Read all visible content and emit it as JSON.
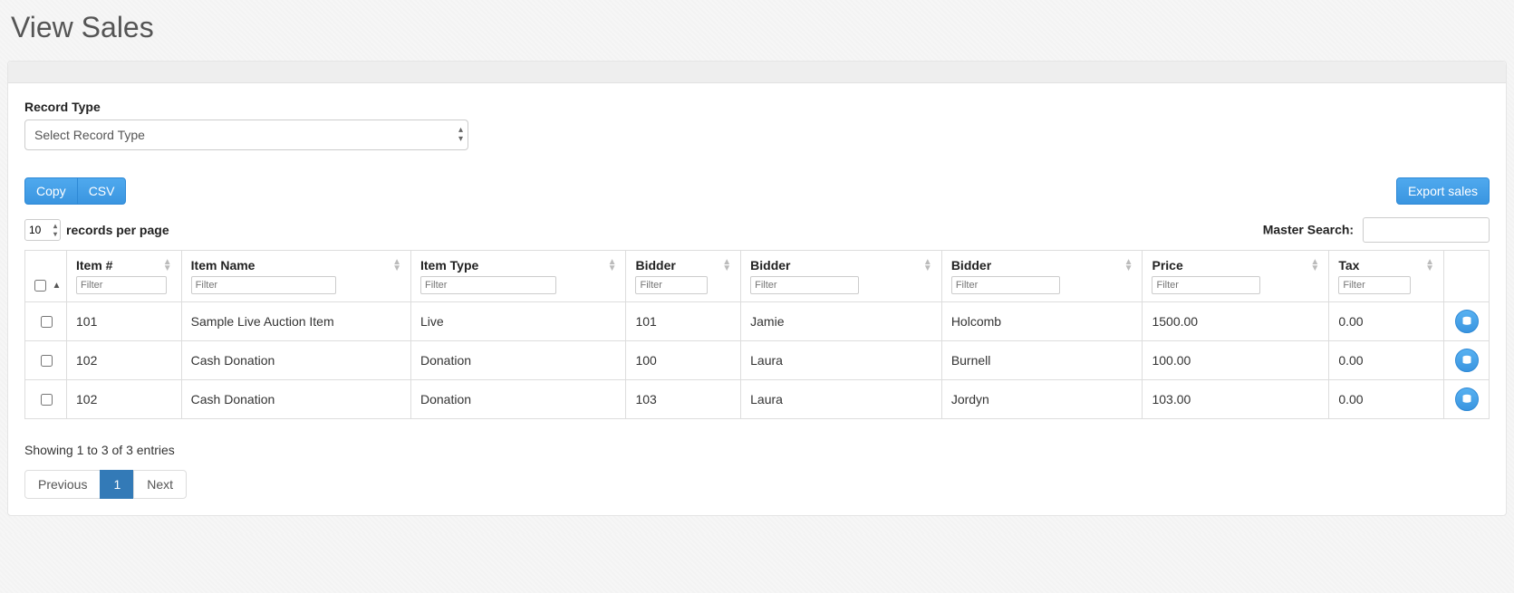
{
  "page": {
    "title": "View Sales"
  },
  "form": {
    "record_type_label": "Record Type",
    "record_type_placeholder": "Select Record Type"
  },
  "toolbar": {
    "copy_label": "Copy",
    "csv_label": "CSV",
    "export_label": "Export sales"
  },
  "table": {
    "page_length_value": "10",
    "records_per_page_label": "records per page",
    "master_search_label": "Master Search:",
    "filter_placeholder": "Filter",
    "columns": {
      "item_num": "Item #",
      "item_name": "Item Name",
      "item_type": "Item Type",
      "bidder_num": "Bidder",
      "bidder_first": "Bidder",
      "bidder_last": "Bidder",
      "price": "Price",
      "tax": "Tax"
    },
    "rows": [
      {
        "item_num": "101",
        "item_name": "Sample Live Auction Item",
        "item_type": "Live",
        "bidder_num": "101",
        "bidder_first": "Jamie",
        "bidder_last": "Holcomb",
        "price": "1500.00",
        "tax": "0.00"
      },
      {
        "item_num": "102",
        "item_name": "Cash Donation",
        "item_type": "Donation",
        "bidder_num": "100",
        "bidder_first": "Laura",
        "bidder_last": "Burnell",
        "price": "100.00",
        "tax": "0.00"
      },
      {
        "item_num": "102",
        "item_name": "Cash Donation",
        "item_type": "Donation",
        "bidder_num": "103",
        "bidder_first": "Laura",
        "bidder_last": "Jordyn",
        "price": "103.00",
        "tax": "0.00"
      }
    ],
    "info_text": "Showing 1 to 3 of 3 entries"
  },
  "pagination": {
    "previous_label": "Previous",
    "page_1_label": "1",
    "next_label": "Next"
  }
}
